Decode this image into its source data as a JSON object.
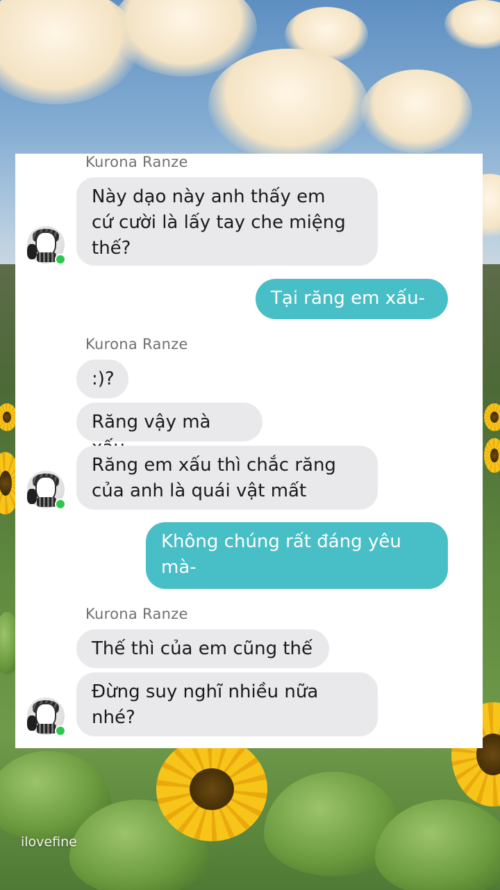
{
  "background": {
    "watermark": "ilovefine"
  },
  "chat": {
    "contact_name": "Kurona Ranze",
    "colors": {
      "incoming_bubble": "#e9e9eb",
      "outgoing_bubble": "#48bec6",
      "online_dot": "#2cc84d"
    },
    "groups": [
      {
        "sender": "Kurona Ranze",
        "messages": [
          {
            "line1": "Này dạo này anh thấy em",
            "line2": "cứ cười là lấy tay che miệng",
            "line3": "thế?"
          }
        ]
      },
      {
        "outgoing": [
          {
            "line1": "Tại răng em xấu-"
          }
        ]
      },
      {
        "sender": "Kurona Ranze",
        "messages": [
          {
            "line1": ":)?"
          },
          {
            "line1": "Răng vậy mà xấu"
          },
          {
            "line1": "Răng em xấu thì chắc răng",
            "line2": "của anh là quái vật mất"
          }
        ]
      },
      {
        "outgoing": [
          {
            "line1": "Không chúng rất đáng yêu",
            "line2": "mà-"
          }
        ]
      },
      {
        "sender": "Kurona Ranze",
        "messages": [
          {
            "line1": "Thế thì của em cũng thế"
          },
          {
            "line1": "Đừng suy nghĩ nhiều nữa",
            "line2": "nhé?"
          }
        ]
      }
    ]
  }
}
